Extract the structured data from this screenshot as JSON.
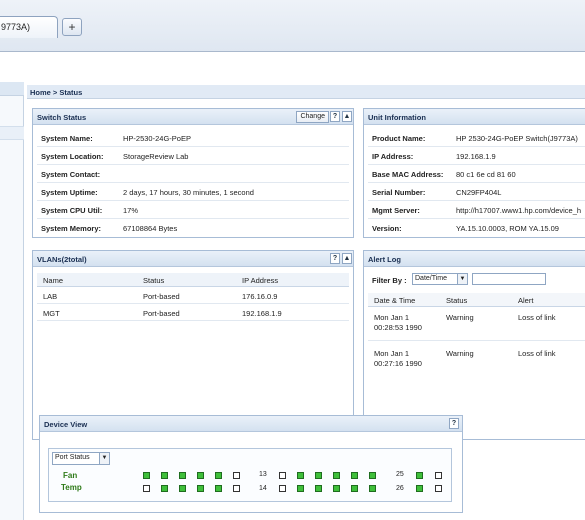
{
  "browser": {
    "tab_title": "9773A)",
    "new_tab_label": "+"
  },
  "breadcrumb": "Home > Status",
  "switch_status": {
    "title": "Switch Status",
    "change_label": "Change",
    "help": "?",
    "collapse": "▲",
    "rows": [
      {
        "label": "System Name:",
        "value": "HP-2530-24G-PoEP"
      },
      {
        "label": "System Location:",
        "value": "StorageReview Lab"
      },
      {
        "label": "System Contact:",
        "value": ""
      },
      {
        "label": "System Uptime:",
        "value": "2 days, 17 hours, 30 minutes, 1 second"
      },
      {
        "label": "System CPU Util:",
        "value": "17%"
      },
      {
        "label": "System Memory:",
        "value": "67108864 Bytes"
      }
    ]
  },
  "unit_information": {
    "title": "Unit Information",
    "rows": [
      {
        "label": "Product Name:",
        "value": "HP 2530-24G-PoEP Switch(J9773A)"
      },
      {
        "label": "IP Address:",
        "value": "192.168.1.9"
      },
      {
        "label": "Base MAC Address:",
        "value": "80 c1 6e cd 81 60"
      },
      {
        "label": "Serial Number:",
        "value": "CN29FP404L"
      },
      {
        "label": "Mgmt Server:",
        "value": "http://h17007.www1.hp.com/device_h"
      },
      {
        "label": "Version:",
        "value": "YA.15.10.0003, ROM YA.15.09"
      }
    ]
  },
  "vlans": {
    "title": "VLANs(2total)",
    "help": "?",
    "collapse": "▲",
    "columns": [
      "Name",
      "Status",
      "IP Address"
    ],
    "rows": [
      [
        "LAB",
        "Port-based",
        "176.16.0.9"
      ],
      [
        "MGT",
        "Port-based",
        "192.168.1.9"
      ]
    ]
  },
  "alert_log": {
    "title": "Alert Log",
    "filter_label": "Filter By :",
    "filter_value": "Date/Time",
    "columns": [
      "Date & Time",
      "Status",
      "Alert"
    ],
    "rows": [
      {
        "date": "Mon Jan 1",
        "time": "00:28:53 1990",
        "status": "Warning",
        "alert": "Loss of link"
      },
      {
        "date": "Mon Jan 1",
        "time": "00:27:16 1990",
        "status": "Warning",
        "alert": "Loss of link"
      }
    ]
  },
  "device_view": {
    "title": "Device View",
    "help": "?",
    "dropdown_value": "Port Status",
    "legend_fan": "Fan",
    "legend_temp": "Temp",
    "port_13": "13",
    "port_14": "14",
    "port_25": "25",
    "port_26": "26",
    "ports_top": [
      "up",
      "up",
      "up",
      "up",
      "up",
      "down",
      "down",
      "up",
      "up",
      "up",
      "up",
      "up",
      "up",
      "down",
      "down"
    ],
    "ports_bottom": [
      "down",
      "up",
      "up",
      "up",
      "up",
      "down",
      "down",
      "up",
      "up",
      "up",
      "up",
      "up",
      "up",
      "down",
      "down"
    ],
    "colors": {
      "up": "#3fbf3a",
      "down": "#ffffff"
    }
  }
}
